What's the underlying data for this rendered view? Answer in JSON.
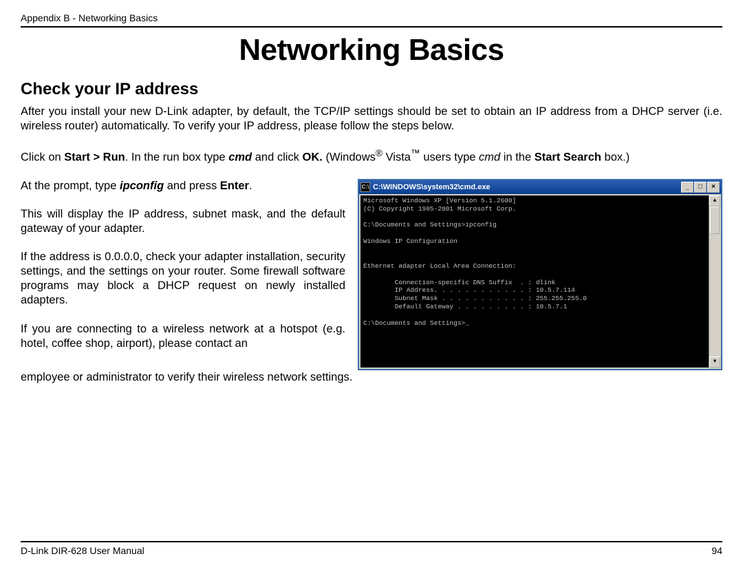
{
  "header": {
    "breadcrumb": "Appendix B - Networking Basics"
  },
  "title": "Networking Basics",
  "subheading": "Check your IP address",
  "paragraphs": {
    "intro": "After you install your new D-Link adapter, by default, the TCP/IP settings should be set to obtain an IP address from a DHCP server (i.e. wireless router) automatically. To verify your IP address, please follow the steps below.",
    "run_prefix": "Click on ",
    "run_start_run": "Start > Run",
    "run_mid1": ". In the run box type ",
    "run_cmd1": "cmd",
    "run_mid2": " and click ",
    "run_ok": "OK.",
    "run_mid3": " (Windows",
    "run_reg": "®",
    "run_vista": " Vista",
    "run_tm": "™",
    "run_mid4": " users type ",
    "run_cmd2": "cmd",
    "run_mid5": " in the ",
    "run_ss": "Start Search",
    "run_end": " box.)",
    "prompt_prefix": "At the prompt, type ",
    "prompt_cmd": "ipconfig",
    "prompt_mid": " and press ",
    "prompt_enter": "Enter",
    "prompt_end": ".",
    "display": "This will display the IP address, subnet mask, and the default gateway of your adapter.",
    "zero": "If the address is 0.0.0.0, check your adapter installation, security settings, and the settings on your router. Some firewall software programs may block a DHCP request on newly installed adapters.",
    "hotspot_left": "If you are connecting to a wireless network at a hotspot (e.g. hotel, coffee shop, airport), please contact an",
    "hotspot_full": "employee or administrator to verify their wireless network settings."
  },
  "cmd": {
    "title": "C:\\WINDOWS\\system32\\cmd.exe",
    "icon_label": "C:\\",
    "min": "_",
    "max": "□",
    "close": "×",
    "up": "▲",
    "down": "▼",
    "output": "Microsoft Windows XP [Version 5.1.2600]\n(C) Copyright 1985-2001 Microsoft Corp.\n\nC:\\Documents and Settings>ipconfig\n\nWindows IP Configuration\n\n\nEthernet adapter Local Area Connection:\n\n        Connection-specific DNS Suffix  . : dlink\n        IP Address. . . . . . . . . . . . : 10.5.7.114\n        Subnet Mask . . . . . . . . . . . : 255.255.255.0\n        Default Gateway . . . . . . . . . : 10.5.7.1\n\nC:\\Documents and Settings>_"
  },
  "footer": {
    "manual": "D-Link DIR-628 User Manual",
    "page": "94"
  }
}
